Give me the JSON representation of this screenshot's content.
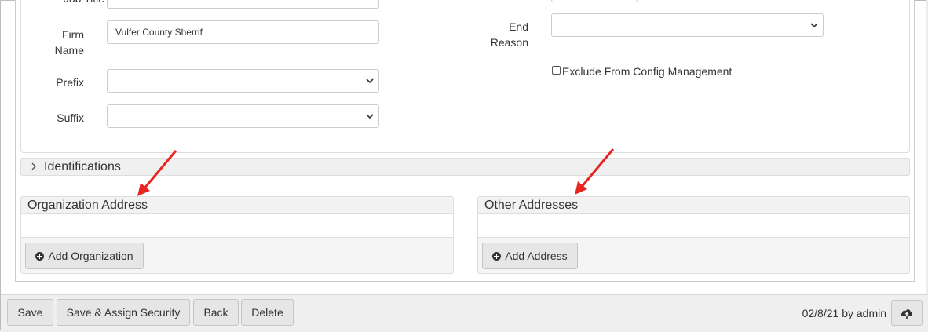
{
  "form": {
    "job_title_label": "Job Title",
    "job_title_value": "",
    "firm_name_label_1": "Firm",
    "firm_name_label_2": "Name",
    "firm_name_value": "Vulfer County Sherrif",
    "prefix_label": "Prefix",
    "prefix_value": "",
    "suffix_label": "Suffix",
    "suffix_value": "",
    "end_reason_label_1": "End",
    "end_reason_label_2": "Reason",
    "end_reason_value": "",
    "exclude_label": "Exclude From Config Management",
    "exclude_checked": false
  },
  "identifications": {
    "title": "Identifications",
    "expanded": false
  },
  "organization_address": {
    "title": "Organization Address",
    "add_button": "Add Organization"
  },
  "other_addresses": {
    "title": "Other Addresses",
    "add_button": "Add Address"
  },
  "footer": {
    "save": "Save",
    "save_assign": "Save & Assign Security",
    "back": "Back",
    "delete": "Delete",
    "meta": "02/8/21 by admin",
    "upload_icon": "cloud-upload-icon"
  },
  "annotations": {
    "arrow_color": "#e8261f"
  }
}
